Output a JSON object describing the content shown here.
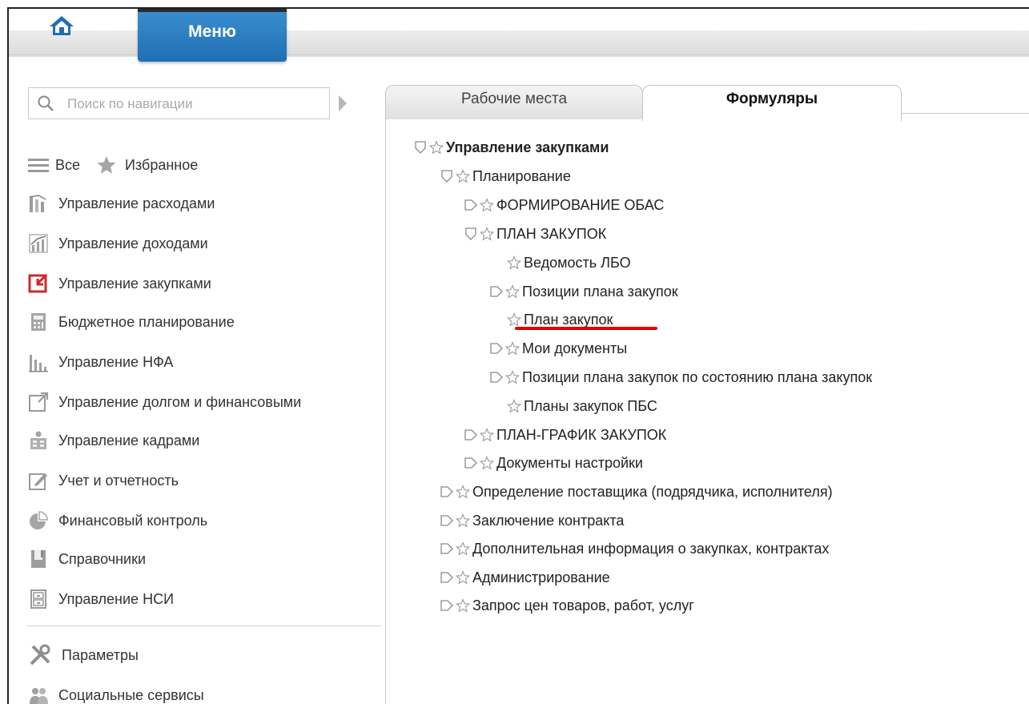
{
  "header": {
    "menu_label": "Меню"
  },
  "search": {
    "placeholder": "Поиск по навигации"
  },
  "nav": {
    "all_label": "Все",
    "favorites_label": "Избранное",
    "items": [
      {
        "label": "Управление расходами",
        "icon": "bar-chart-icon"
      },
      {
        "label": "Управление доходами",
        "icon": "growth-chart-icon"
      },
      {
        "label": "Управление закупками",
        "icon": "procurement-icon"
      },
      {
        "label": "Бюджетное планирование",
        "icon": "calculator-icon"
      },
      {
        "label": "Управление НФА",
        "icon": "column-chart-icon"
      },
      {
        "label": "Управление долгом и финансовыми",
        "icon": "external-link-icon"
      },
      {
        "label": "Управление кадрами",
        "icon": "staff-icon"
      },
      {
        "label": "Учет и отчетность",
        "icon": "edit-icon"
      },
      {
        "label": "Финансовый контроль",
        "icon": "pie-chart-icon"
      },
      {
        "label": "Справочники",
        "icon": "book-icon"
      },
      {
        "label": "Управление НСИ",
        "icon": "cabinet-icon"
      }
    ],
    "bottom": [
      {
        "label": "Параметры",
        "icon": "tools-icon"
      },
      {
        "label": "Социальные сервисы",
        "icon": "users-icon"
      }
    ]
  },
  "tabs": {
    "workplaces": "Рабочие места",
    "forms": "Формуляры"
  },
  "tree": [
    {
      "label": "Управление закупками",
      "state": "expanded"
    },
    {
      "label": "Планирование",
      "state": "expanded"
    },
    {
      "label": "ФОРМИРОВАНИЕ ОБАС",
      "state": "collapsed"
    },
    {
      "label": "ПЛАН ЗАКУПОК",
      "state": "expanded"
    },
    {
      "label": "Ведомость ЛБО",
      "state": "leaf"
    },
    {
      "label": "Позиции плана закупок",
      "state": "collapsed"
    },
    {
      "label": "План закупок",
      "state": "leaf"
    },
    {
      "label": "Мои документы",
      "state": "collapsed"
    },
    {
      "label": "Позиции плана закупок по состоянию плана закупок",
      "state": "collapsed"
    },
    {
      "label": "Планы закупок ПБС",
      "state": "leaf"
    },
    {
      "label": "ПЛАН-ГРАФИК ЗАКУПОК",
      "state": "collapsed"
    },
    {
      "label": "Документы настройки",
      "state": "collapsed"
    },
    {
      "label": "Определение поставщика (подрядчика, исполнителя)",
      "state": "collapsed"
    },
    {
      "label": "Заключение контракта",
      "state": "collapsed"
    },
    {
      "label": "Дополнительная информация о закупках, контрактах",
      "state": "collapsed"
    },
    {
      "label": "Администрирование",
      "state": "collapsed"
    },
    {
      "label": "Запрос цен товаров, работ, услуг",
      "state": "collapsed"
    }
  ],
  "colors": {
    "accent_blue": "#2a7fc4",
    "highlight_red": "#e00000",
    "procurement_red": "#d0282e"
  }
}
